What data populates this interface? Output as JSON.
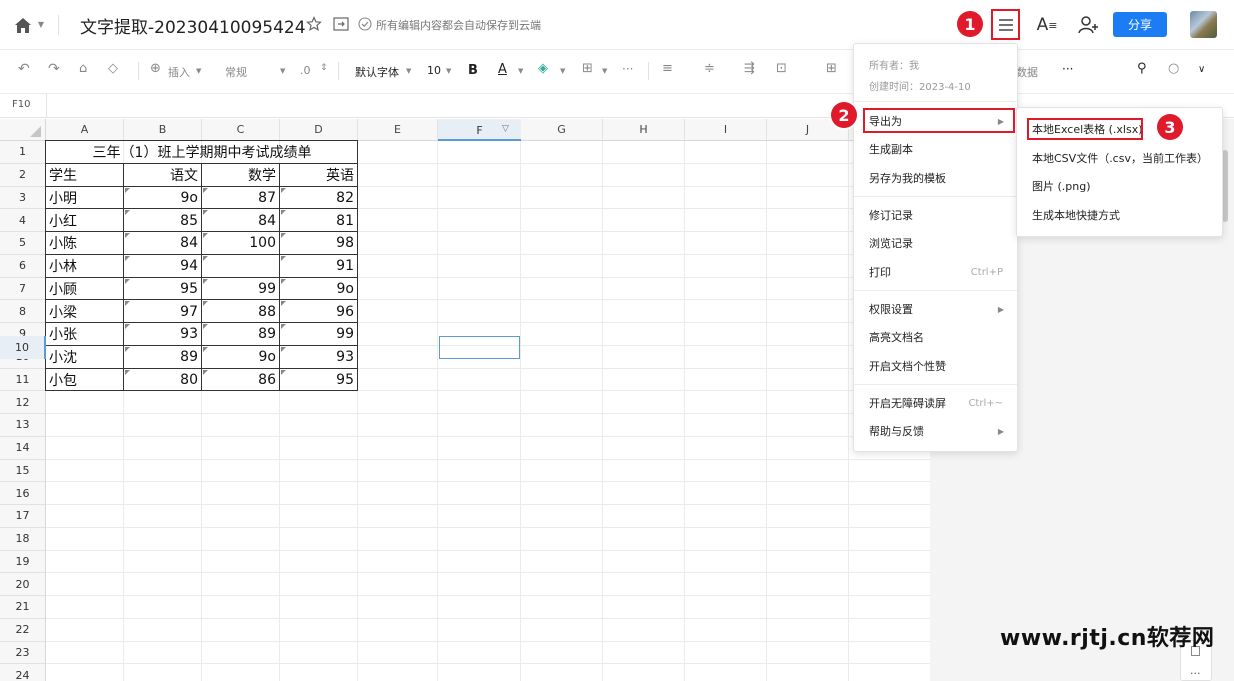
{
  "header": {
    "title": "文字提取-20230410095424",
    "save_status": "所有编辑内容都会自动保存到云端",
    "share_label": "分享"
  },
  "toolbar": {
    "insert": "插入",
    "format": "常规",
    "decimal": ".0",
    "font": "默认字体",
    "font_size": "10",
    "bold": "B",
    "font_color": "A",
    "data": "数据",
    "more": "···"
  },
  "formula_bar": {
    "cell_ref": "F10"
  },
  "sheet": {
    "columns": [
      "A",
      "B",
      "C",
      "D",
      "E",
      "F",
      "G",
      "H",
      "I",
      "J"
    ],
    "rows": [
      "1",
      "2",
      "3",
      "4",
      "5",
      "6",
      "7",
      "8",
      "9",
      "10",
      "11",
      "12",
      "13",
      "14",
      "15",
      "16",
      "17",
      "18",
      "19",
      "20",
      "21",
      "22",
      "23",
      "24"
    ],
    "table_title": "三年（1）班上学期期中考试成绩单",
    "headers": [
      "学生",
      "语文",
      "数学",
      "英语"
    ],
    "records": [
      [
        "小明",
        "9o",
        "87",
        "82"
      ],
      [
        "小红",
        "85",
        "84",
        "81"
      ],
      [
        "小陈",
        "84",
        "100",
        "98"
      ],
      [
        "小林",
        "94",
        "",
        "91"
      ],
      [
        "小顾",
        "95",
        "99",
        "9o"
      ],
      [
        "小梁",
        "97",
        "88",
        "96"
      ],
      [
        "小张",
        "93",
        "89",
        "99"
      ],
      [
        "小沈",
        "89",
        "9o",
        "93"
      ],
      [
        "小包",
        "80",
        "86",
        "95"
      ]
    ]
  },
  "main_menu": {
    "owner": "所有者：我",
    "created": "创建时间：2023-4-10",
    "items": {
      "export": "导出为",
      "copy": "生成副本",
      "template": "另存为我的模板",
      "revisions": "修订记录",
      "browse": "浏览记录",
      "print": "打印",
      "print_shortcut": "Ctrl+P",
      "permission": "权限设置",
      "highlight": "高亮文档名",
      "like": "开启文档个性赞",
      "accessible": "开启无障碍读屏",
      "accessible_shortcut": "Ctrl+~",
      "help": "帮助与反馈"
    }
  },
  "export_submenu": {
    "xlsx": "本地Excel表格 (.xlsx)",
    "csv": "本地CSV文件（.csv，当前工作表）",
    "png": "图片 (.png)",
    "shortcut": "生成本地快捷方式"
  },
  "annotations": {
    "step1": "1",
    "step2": "2",
    "step3": "3"
  },
  "watermark": "www.rjtj.cn软荐网",
  "more_dots": "···",
  "colors": {
    "accent": "#1c7cf4",
    "annotation_red": "#e0192b"
  }
}
